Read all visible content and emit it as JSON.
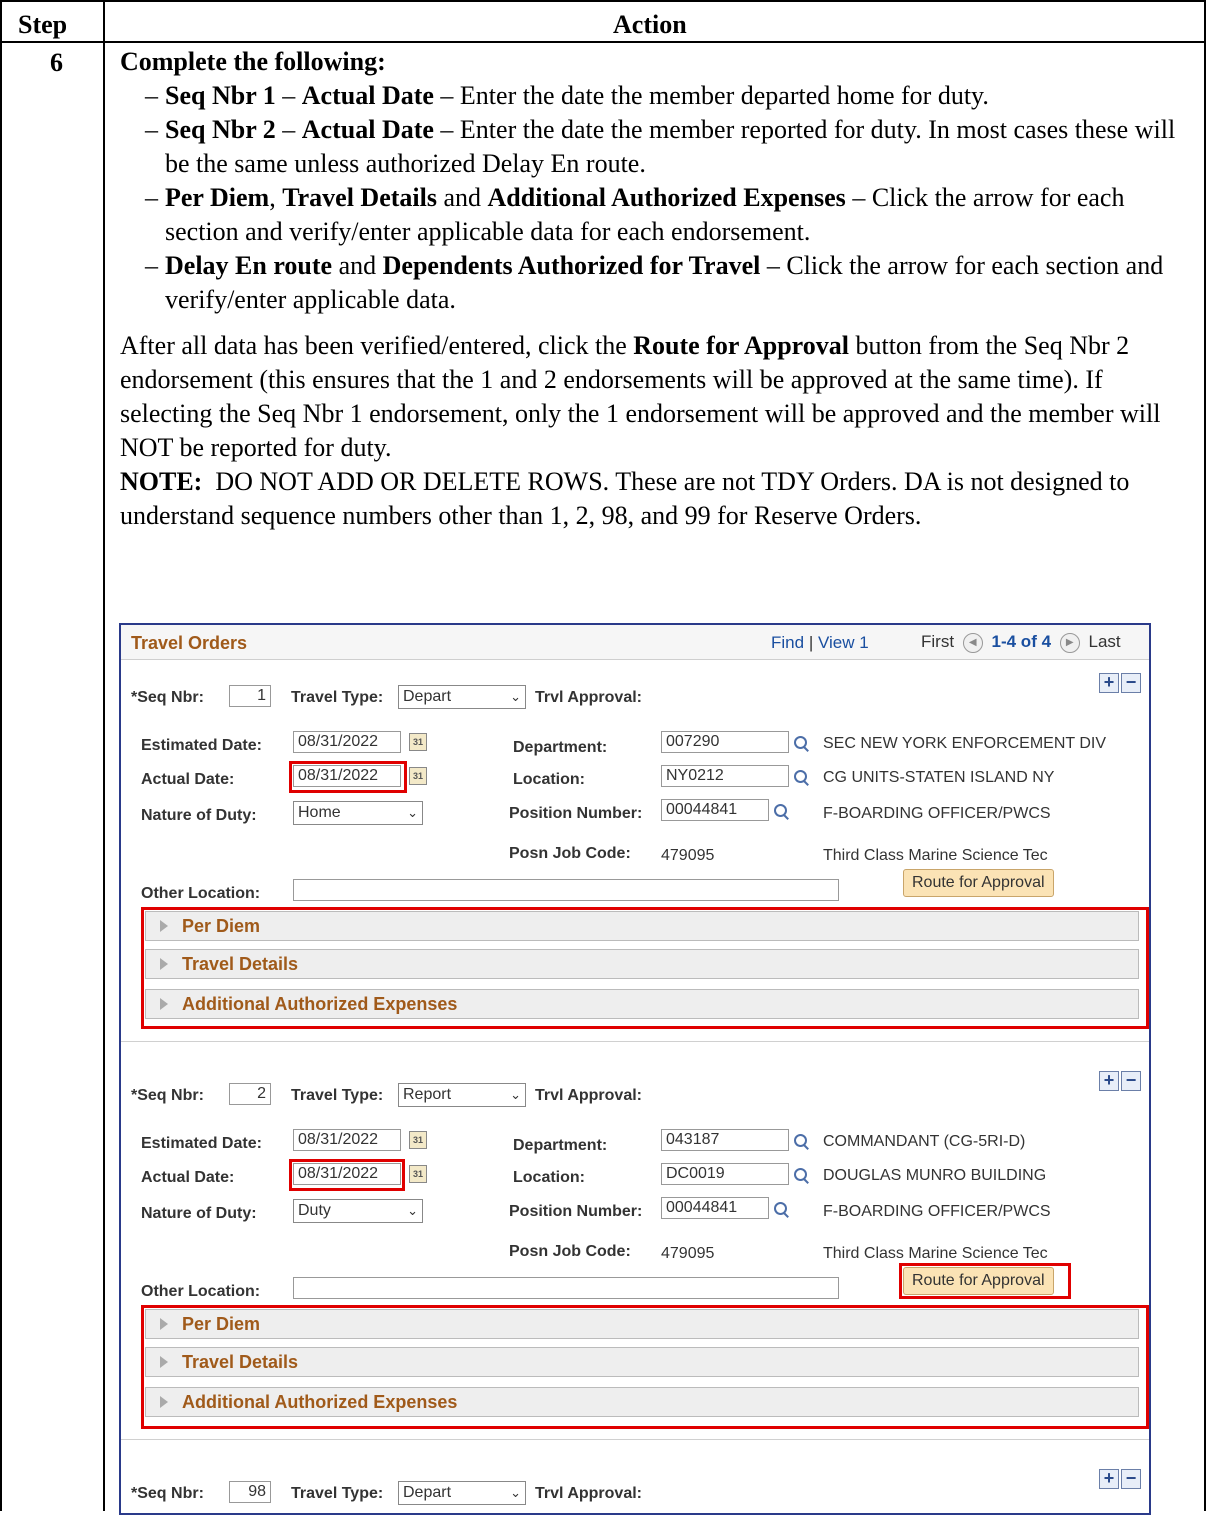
{
  "table": {
    "header_step": "Step",
    "header_action": "Action",
    "step_number": "6"
  },
  "instructions": {
    "lead": "Complete the following:",
    "bullets": [
      {
        "b1": "Seq Nbr 1",
        "sep1": " – ",
        "b2": "Actual Date",
        "rest": " – Enter the date the member departed home for duty."
      },
      {
        "b1": "Seq Nbr 2",
        "sep1": " – ",
        "b2": "Actual Date",
        "rest": " – Enter the date the member reported for duty. In most cases these will be the same unless authorized Delay En route."
      },
      {
        "b1": "Per Diem",
        "sep1": ", ",
        "b2": "Travel Details",
        "mid": " and ",
        "b3": "Additional Authorized Expenses",
        "rest": " – Click the arrow for each section and verify/enter applicable data for each endorsement."
      },
      {
        "b1": "Delay En route",
        "mid": " and ",
        "b2": "Dependents Authorized for Travel",
        "rest": " – Click the arrow for each section and verify/enter applicable data."
      }
    ],
    "para_start": "After all data has been verified/entered, click the ",
    "para_bold": "Route for Approval",
    "para_end": " button from the Seq Nbr 2 endorsement (this ensures that the 1 and 2 endorsements will be approved at the same time). If selecting the Seq Nbr 1 endorsement, only the 1 endorsement will be approved and the member will NOT be reported for duty.",
    "note_label": "NOTE:",
    "note_text": "  DO NOT ADD OR DELETE ROWS. These are not TDY Orders. DA is not designed to understand sequence numbers other than 1, 2, 98, and 99 for Reserve Orders."
  },
  "screen": {
    "title": "Travel Orders",
    "find": "Find",
    "divider": "|",
    "view": "View 1",
    "first": "First",
    "count": "1-4 of 4",
    "last": "Last",
    "labels": {
      "seq": "*Seq Nbr:",
      "travel_type": "Travel Type:",
      "trvl_approval": "Trvl Approval:",
      "estimated_date": "Estimated Date:",
      "actual_date": "Actual Date:",
      "nature_of_duty": "Nature of Duty:",
      "department": "Department:",
      "location": "Location:",
      "position_number": "Position Number:",
      "posn_job_code": "Posn Job Code:",
      "other_location": "Other Location:",
      "route": "Route for Approval"
    },
    "sections": [
      "Per Diem",
      "Travel Details",
      "Additional Authorized Expenses"
    ],
    "rows": [
      {
        "seq": "1",
        "travel_type": "Depart",
        "estimated_date": "08/31/2022",
        "actual_date": "08/31/2022",
        "nature_of_duty": "Home",
        "department": "007290",
        "department_desc": "SEC NEW YORK ENFORCEMENT DIV",
        "location": "NY0212",
        "location_desc": "CG UNITS-STATEN ISLAND NY",
        "position_number": "00044841",
        "position_desc": "F-BOARDING OFFICER/PWCS",
        "posn_job_code": "479095",
        "job_desc": "Third Class Marine Science Tec"
      },
      {
        "seq": "2",
        "travel_type": "Report",
        "estimated_date": "08/31/2022",
        "actual_date": "08/31/2022",
        "nature_of_duty": "Duty",
        "department": "043187",
        "department_desc": "COMMANDANT (CG-5RI-D)",
        "location": "DC0019",
        "location_desc": "DOUGLAS MUNRO BUILDING",
        "position_number": "00044841",
        "position_desc": "F-BOARDING OFFICER/PWCS",
        "posn_job_code": "479095",
        "job_desc": "Third Class Marine Science Tec"
      },
      {
        "seq": "98",
        "travel_type": "Depart"
      }
    ]
  },
  "icons": [
    "calendar-icon",
    "lookup-icon",
    "add-row-icon",
    "delete-row-icon",
    "expand-arrow-icon",
    "nav-prev-icon",
    "nav-next-icon"
  ],
  "colors": {
    "highlight": "#e00000",
    "section_title": "#a05a1a",
    "link": "#1a4fa0"
  }
}
